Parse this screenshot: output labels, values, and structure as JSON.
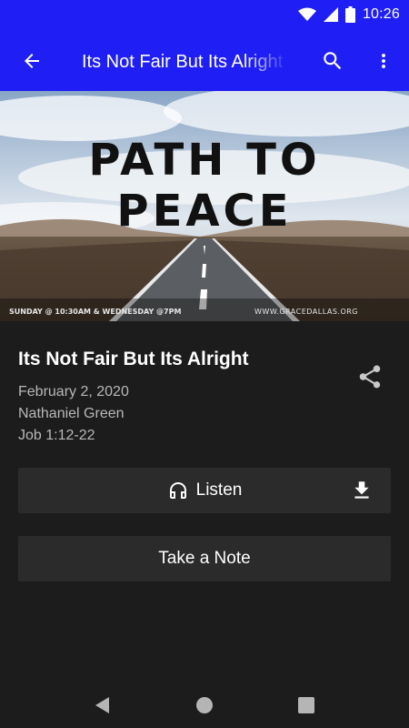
{
  "status_bar": {
    "time": "10:26"
  },
  "app_bar": {
    "title": "Its Not Fair But Its Alright"
  },
  "banner": {
    "line1": "PATH TO",
    "line2": "PEACE",
    "schedule": "SUNDAY @ 10:30AM & WEDNESDAY @7PM",
    "website": "WWW.GRACEDALLAS.ORG"
  },
  "sermon": {
    "title": "Its Not Fair But Its Alright",
    "date": "February 2, 2020",
    "speaker": "Nathaniel Green",
    "scripture": "Job 1:12-22"
  },
  "actions": {
    "listen_label": "Listen",
    "note_label": "Take a Note"
  },
  "icons": {
    "back": "arrow-back-icon",
    "search": "search-icon",
    "more": "more-vert-icon",
    "share": "share-icon",
    "headphones": "headphones-icon",
    "download": "download-icon",
    "nav_back": "nav-back-icon",
    "nav_home": "nav-home-icon",
    "nav_recents": "nav-recents-icon"
  },
  "colors": {
    "app_bar": "#1f1ff5",
    "background": "#1c1c1d",
    "button_bg": "#2b2b2c",
    "secondary_text": "#b8b8b8"
  }
}
